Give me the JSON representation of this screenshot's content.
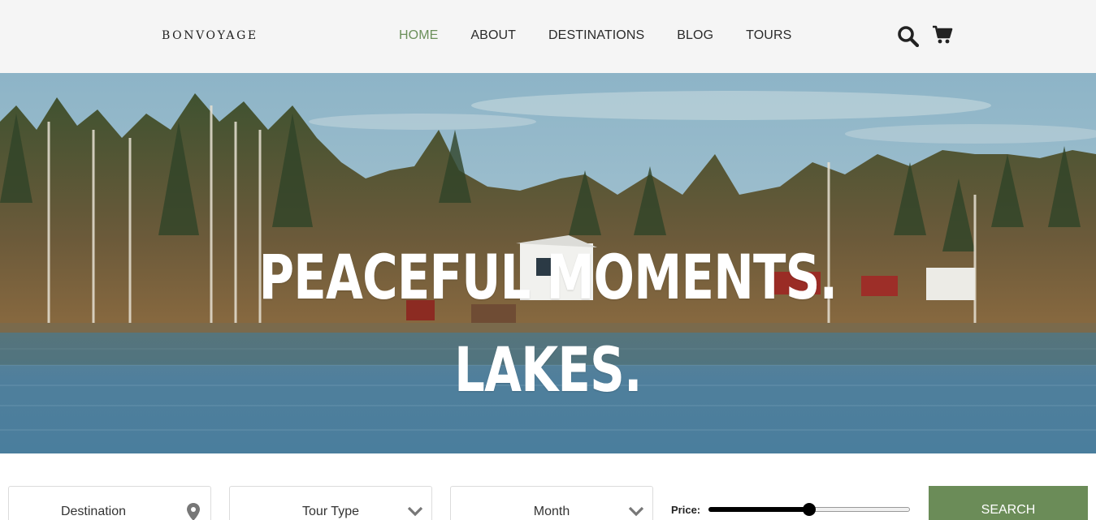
{
  "header": {
    "logo": "BONVOYAGE",
    "nav": [
      {
        "label": "HOME",
        "active": true
      },
      {
        "label": "ABOUT",
        "active": false
      },
      {
        "label": "DESTINATIONS",
        "active": false
      },
      {
        "label": "BLOG",
        "active": false
      },
      {
        "label": "TOURS",
        "active": false
      }
    ],
    "icons": [
      "search-icon",
      "cart-icon"
    ]
  },
  "hero": {
    "line1": "PEACEFUL MOMENTS.",
    "line2": "LAKES."
  },
  "search": {
    "destination_label": "Destination",
    "tour_type_label": "Tour Type",
    "month_label": "Month",
    "price_label": "Price:",
    "price_fraction": 0.5,
    "button_label": "SEARCH"
  },
  "colors": {
    "accent": "#6b8c58",
    "nav_active": "#6b8f5a",
    "header_bg": "#f5f5f5"
  }
}
